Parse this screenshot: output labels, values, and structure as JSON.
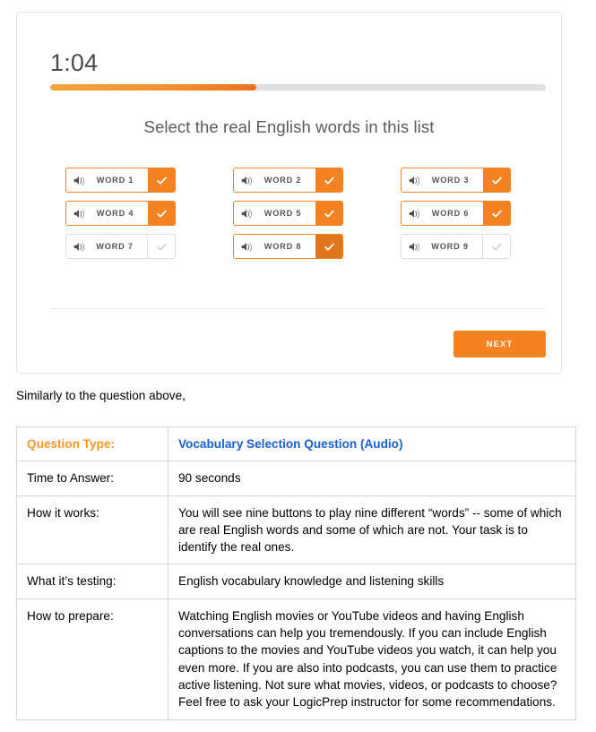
{
  "quiz": {
    "timer": "1:04",
    "progress_percent": 41.6,
    "prompt": "Select the real English words in this list",
    "next_label": "NEXT",
    "colors": {
      "accent_orange": "#f58220",
      "accent_orange_dark": "#e1761d",
      "track_gray": "#e0e0e0",
      "border_gray": "#dcdcdc"
    },
    "words": [
      {
        "label": "WORD 1",
        "selected": true,
        "check_state": "on",
        "icon": "speaker-icon"
      },
      {
        "label": "WORD 2",
        "selected": true,
        "check_state": "on",
        "icon": "speaker-icon"
      },
      {
        "label": "WORD 3",
        "selected": true,
        "check_state": "on",
        "icon": "speaker-icon"
      },
      {
        "label": "WORD 4",
        "selected": true,
        "check_state": "on",
        "icon": "speaker-icon"
      },
      {
        "label": "WORD 5",
        "selected": true,
        "check_state": "on",
        "icon": "speaker-icon"
      },
      {
        "label": "WORD 6",
        "selected": true,
        "check_state": "on",
        "icon": "speaker-icon"
      },
      {
        "label": "WORD 7",
        "selected": false,
        "check_state": "off",
        "icon": "speaker-icon"
      },
      {
        "label": "WORD 8",
        "selected": true,
        "check_state": "on-dark",
        "icon": "speaker-icon"
      },
      {
        "label": "WORD 9",
        "selected": false,
        "check_state": "off",
        "icon": "speaker-icon"
      }
    ]
  },
  "caption": "Similarly to the question above,",
  "info_table": {
    "rows": [
      {
        "key": "Question Type:",
        "value": "Vocabulary Selection Question (Audio)",
        "is_header": true
      },
      {
        "key": "Time to Answer:",
        "value": "90 seconds",
        "is_header": false
      },
      {
        "key": "How it works:",
        "value": "You will see nine buttons to play nine different “words” -- some of which are real English words and some of which are not. Your task is to identify the real ones.",
        "is_header": false
      },
      {
        "key": "What it’s testing:",
        "value": "English vocabulary knowledge and listening skills",
        "is_header": false
      },
      {
        "key": "How to prepare:",
        "value": "Watching English movies or YouTube videos and having English conversations can help you tremendously. If you can include English captions to the movies and YouTube videos you watch, it can help you even more. If you are also into podcasts, you can use them to practice active listening. Not sure what movies, videos, or podcasts to choose? Feel free to ask your LogicPrep instructor for some recommendations.",
        "is_header": false
      }
    ]
  }
}
